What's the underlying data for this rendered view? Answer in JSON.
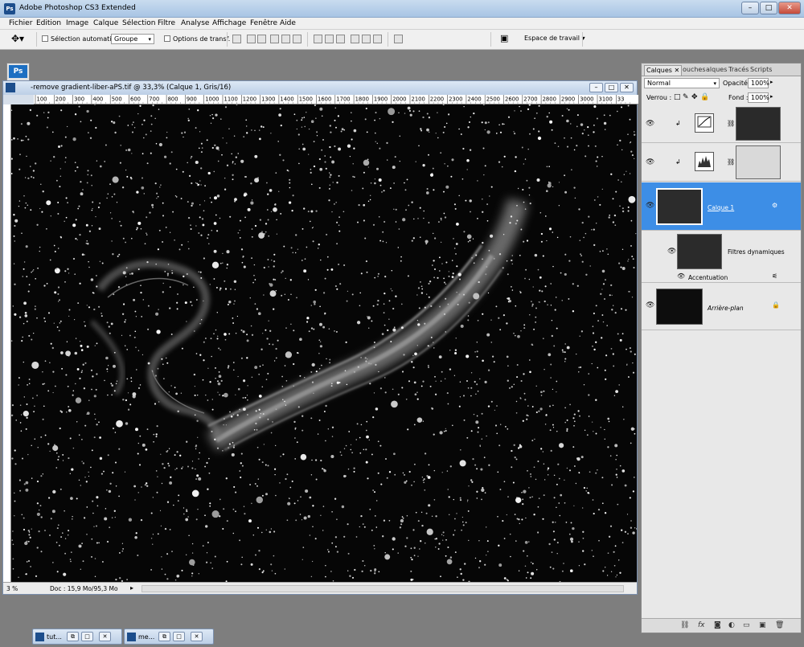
{
  "window": {
    "title": "Adobe Photoshop CS3 Extended",
    "icon": "Ps",
    "buttons": [
      "–",
      "□",
      "✕"
    ]
  },
  "menu": [
    "Fichier",
    "Edition",
    "Image",
    "Calque",
    "Sélection",
    "Filtre",
    "Analyse",
    "Affichage",
    "Fenêtre",
    "Aide"
  ],
  "options": {
    "auto_select_label": "Sélection automatique :",
    "auto_select_value": "Groupe",
    "transform_label": "Options de transf.",
    "workspace_label": "Espace de travail"
  },
  "toolbox": {
    "logo": "Ps",
    "tools": [
      "move-icon",
      "marquee-icon",
      "lasso-icon",
      "quick-select-icon",
      "crop-icon",
      "eyedropper-icon",
      "healing-icon",
      "brush-icon",
      "stamp-icon",
      "history-brush-icon",
      "eraser-icon",
      "bucket-icon",
      "blur-icon",
      "dodge-icon",
      "pen-icon",
      "type-icon",
      "path-select-icon",
      "shape-icon",
      "notes-icon",
      "eyedropper2-icon",
      "hand-icon",
      "zoom-icon"
    ]
  },
  "document": {
    "title": "-remove gradient-liber-aPS.tif @ 33,3% (Calque 1, Gris/16)",
    "ruler_labels": [
      "100",
      "200",
      "300",
      "400",
      "500",
      "600",
      "700",
      "800",
      "900",
      "1000",
      "1100",
      "1200",
      "1300",
      "1400",
      "1500",
      "1600",
      "1700",
      "1800",
      "1900",
      "2000",
      "2100",
      "2200",
      "2300",
      "2400",
      "2500",
      "2600",
      "2700",
      "2800",
      "2900",
      "3000",
      "3100",
      "33"
    ],
    "zoom": "3 %",
    "doc_info": "Doc : 15,9 Mo/95,3 Mo"
  },
  "layers_panel": {
    "tabs": [
      "Calques",
      "ouches",
      "alques",
      "Tracés",
      "Scripts"
    ],
    "blend_mode": "Normal",
    "opacity_label": "Opacité :",
    "opacity_value": "100%",
    "lock_label": "Verrou :",
    "fill_label": "Fond :",
    "fill_value": "100%",
    "layers": [
      {
        "name": "",
        "type": "curves-adjustment"
      },
      {
        "name": "",
        "type": "levels-adjustment"
      },
      {
        "name": "Calque 1",
        "type": "smart-object",
        "selected": true
      },
      {
        "name": "Filtres dynamiques",
        "type": "smart-filters"
      },
      {
        "name": "Accentuation",
        "type": "filter"
      },
      {
        "name": "Arrière-plan",
        "type": "background"
      }
    ]
  },
  "minimized_windows": [
    {
      "label": "tut..."
    },
    {
      "label": "me..."
    }
  ]
}
